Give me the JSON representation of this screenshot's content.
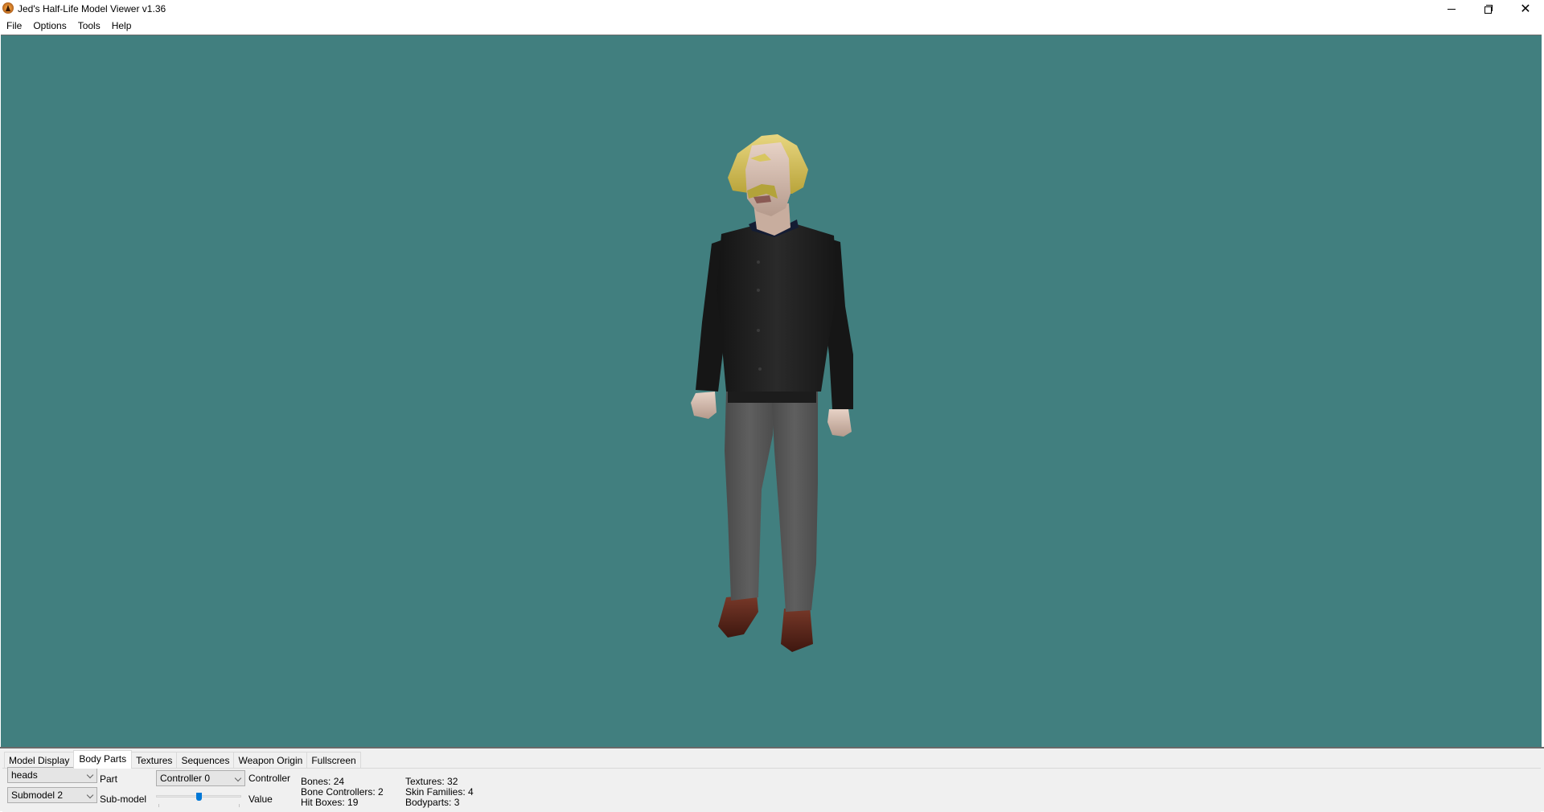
{
  "window": {
    "title": "Jed's Half-Life Model Viewer v1.36",
    "app_icon": "half-life-lambda-icon",
    "controls": {
      "minimize": "minimize-icon",
      "maximize": "restore-icon",
      "close": "close-icon"
    }
  },
  "menubar": {
    "items": [
      "File",
      "Options",
      "Tools",
      "Help"
    ]
  },
  "viewport": {
    "background_color": "#417f7f",
    "model_description": "Scientist character model (blond hair, mustache, black shirt, grey trousers, brown shoes)"
  },
  "panel": {
    "tabs": [
      {
        "label": "Model Display",
        "active": false
      },
      {
        "label": "Body Parts",
        "active": true
      },
      {
        "label": "Textures",
        "active": false
      },
      {
        "label": "Sequences",
        "active": false
      },
      {
        "label": "Weapon Origin",
        "active": false
      },
      {
        "label": "Fullscreen",
        "active": false
      }
    ],
    "body_parts": {
      "part_select": {
        "value": "heads",
        "label": "Part"
      },
      "submodel_select": {
        "value": "Submodel 2",
        "label": "Sub-model"
      },
      "controller_select": {
        "value": "Controller 0",
        "label": "Controller"
      },
      "value_slider": {
        "label": "Value",
        "position_fraction": 0.5
      },
      "stats_left": [
        "Bones: 24",
        "Bone Controllers: 2",
        "Hit Boxes: 19"
      ],
      "stats_right": [
        "Textures: 32",
        "Skin Families: 4",
        "Bodyparts: 3"
      ]
    }
  }
}
